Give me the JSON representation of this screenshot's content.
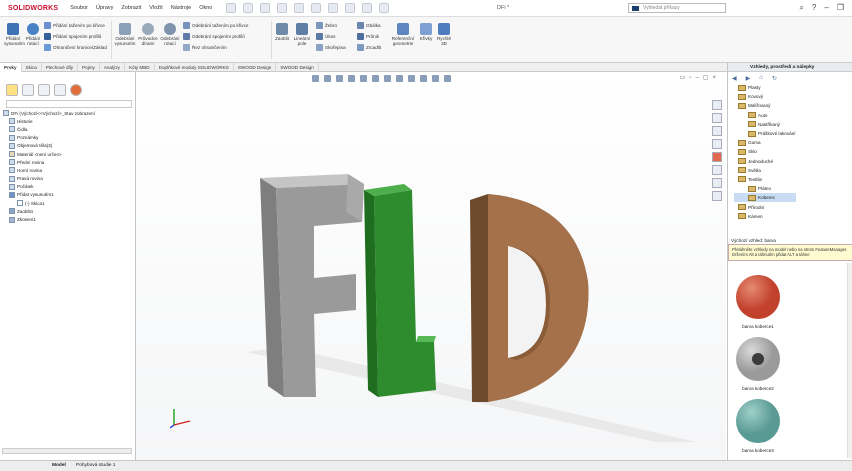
{
  "app": {
    "logo_brand": "SOLIDWORKS",
    "document_title": "DFi *"
  },
  "menu": [
    "Soubor",
    "Úpravy",
    "Zobrazit",
    "Vložit",
    "Nástroje",
    "Okno"
  ],
  "search": {
    "placeholder": "Vyhledat příkazy"
  },
  "ribbon": {
    "extrude": "Přidání vysunutím",
    "revolve": "Přidání rotací",
    "swept_boss": "Přidání tažením po křivce",
    "lofted_boss": "Přidání spojením profilů",
    "boundary_boss": "Ohraničení hranice/Základ",
    "extruded_cut": "Odebrání vysunutím",
    "hole_wizard": "Průvodce dírami",
    "revolved_cut": "Odebrání rotací",
    "swept_cut": "Odebrání tažením po křivce",
    "lofted_cut": "Odebrání spojením profilů",
    "boundary_cut": "Řez ohraničením",
    "fillet": "Zaoblit",
    "linear_pattern": "Lineární pole",
    "rib": "Žebro",
    "draft": "Úkos",
    "shell": "Skořepina",
    "wrap": "Obálka",
    "intersect": "Průnik",
    "mirror": "Zrcadlit",
    "ref_geometry": "Referenční geometrie",
    "curves": "Křivky",
    "instant3d": "Rychlé 3D"
  },
  "command_tabs": [
    "Prvky",
    "Skica",
    "Plechové díly",
    "Pojmy",
    "Analýzy",
    "Kóty MBD",
    "Doplňkové moduly SOLIDWORKS",
    "SWOOD Design",
    "SWOOD Design"
  ],
  "feature_tree": [
    "DFi  (Výchozí<<Výchozí>_Stav zobrazení",
    "Historie",
    "Čidla",
    "Poznámky",
    "Objemová těla(3)",
    "Materiál <není určen>",
    "Přední rovina",
    "Horní rovina",
    "Pravá rovina",
    "Počátek",
    "Přidat vysunutím1",
    "(-) Skica1",
    "Zaoblit1",
    "Zkosení1"
  ],
  "right_panel": {
    "title": "Vzhledy, prostředí a nálepky",
    "tree": [
      "Plasty",
      "Kovový",
      "Malířovaný",
      "Auto",
      "Nastříkaný",
      "Práškové lakování",
      "Guma",
      "Sklo",
      "Jednoduché",
      "Světla",
      "Textilie",
      "Plátno",
      "Koberec",
      "Přírodní",
      "Kámen"
    ],
    "default_label": "Výchozí vzhled: barva",
    "tooltip": "Přetáhněte vzhledy na model nebo na strom FeatureManager. Držením Alt a táhnutím přidat ALT a táhne",
    "thumbnails": [
      {
        "label": "barva koberce1",
        "color": "#c2412d"
      },
      {
        "label": "barva koberce2",
        "color": "#9a9a9a"
      },
      {
        "label": "barva koberce3",
        "color": "#5a9a94"
      }
    ]
  },
  "bottom": {
    "tabs": [
      "Model",
      "Pohybová studie 1"
    ]
  },
  "colors": {
    "accent": "#c8102e",
    "letter_f": "#9a9a9a",
    "letter_l": "#2e8b2e",
    "letter_d": "#a5714a"
  }
}
